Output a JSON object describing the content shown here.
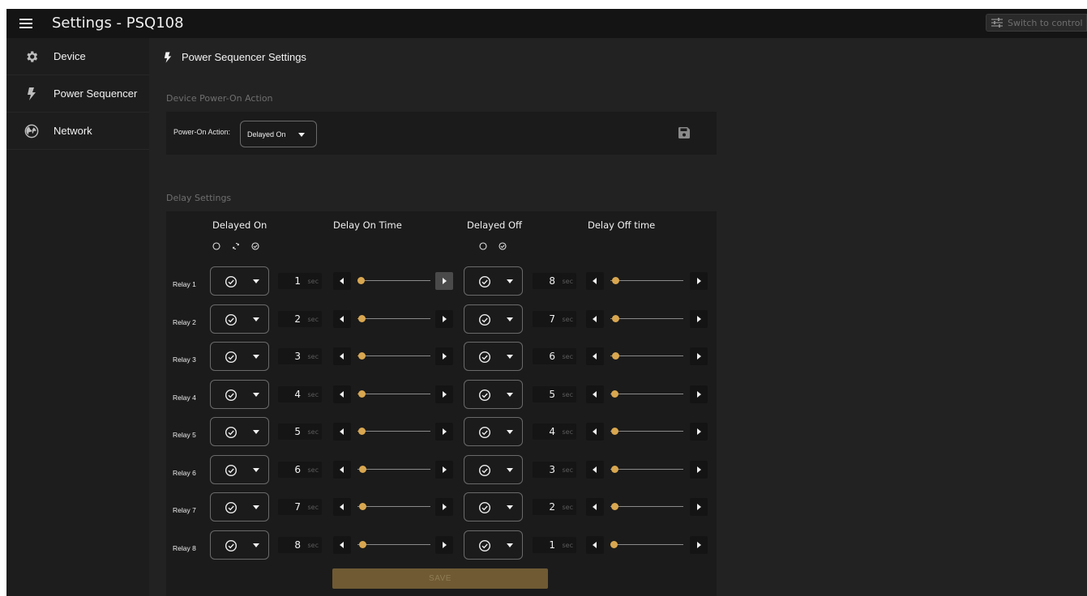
{
  "app": {
    "title": "Settings - PSQ108",
    "switch_label": "Switch to control"
  },
  "sidebar": {
    "items": [
      {
        "label": "Device",
        "icon": "gear-icon"
      },
      {
        "label": "Power Sequencer",
        "icon": "bolt-icon"
      },
      {
        "label": "Network",
        "icon": "globe-icon"
      }
    ]
  },
  "main": {
    "header": "Power Sequencer Settings",
    "poweron": {
      "group_label": "Device Power-On Action",
      "field_label": "Power-On Action:",
      "selected": "Delayed On"
    },
    "delay": {
      "group_label": "Delay Settings",
      "columns": {
        "delayed_on": "Delayed On",
        "delay_on_time": "Delay On Time",
        "delayed_off": "Delayed Off",
        "delay_off_time": "Delay Off time"
      },
      "unit": "sec",
      "relays": [
        {
          "name": "Relay 1",
          "on_time": 1,
          "off_time": 8
        },
        {
          "name": "Relay 2",
          "on_time": 2,
          "off_time": 7
        },
        {
          "name": "Relay 3",
          "on_time": 3,
          "off_time": 6
        },
        {
          "name": "Relay 4",
          "on_time": 4,
          "off_time": 5
        },
        {
          "name": "Relay 5",
          "on_time": 5,
          "off_time": 4
        },
        {
          "name": "Relay 6",
          "on_time": 6,
          "off_time": 3
        },
        {
          "name": "Relay 7",
          "on_time": 7,
          "off_time": 2
        },
        {
          "name": "Relay 8",
          "on_time": 8,
          "off_time": 1
        }
      ],
      "slider_max": 300,
      "save_label": "SAVE"
    }
  },
  "colors": {
    "accent": "#d9a750",
    "background": "#222222",
    "card": "#1b1b1b"
  }
}
